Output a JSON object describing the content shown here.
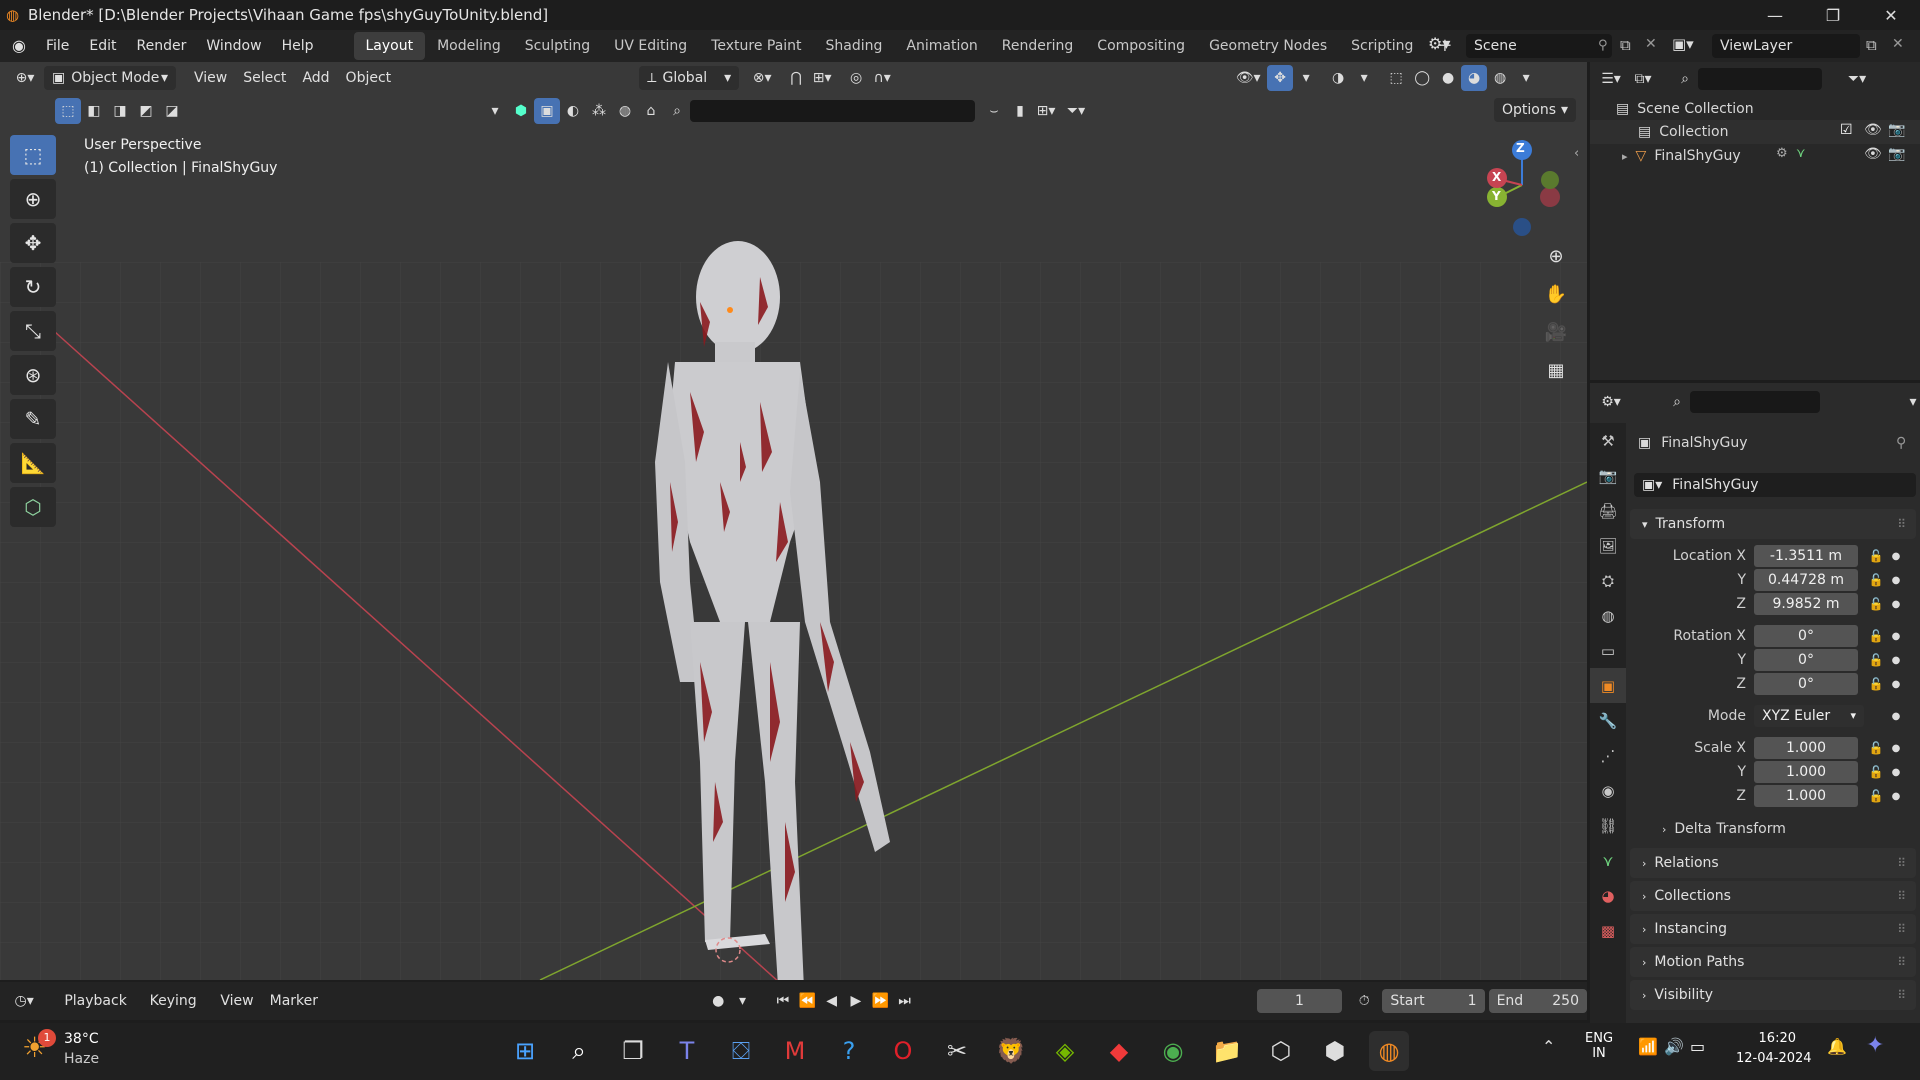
{
  "window": {
    "title": "Blender* [D:\\Blender Projects\\Vihaan Game fps\\shyGuyToUnity.blend]",
    "controls": [
      "—",
      "❐",
      "✕"
    ]
  },
  "menubar": {
    "menus": [
      "File",
      "Edit",
      "Render",
      "Window",
      "Help"
    ],
    "workspaces": [
      "Layout",
      "Modeling",
      "Sculpting",
      "UV Editing",
      "Texture Paint",
      "Shading",
      "Animation",
      "Rendering",
      "Compositing",
      "Geometry Nodes",
      "Scripting"
    ],
    "active_workspace": "Layout",
    "add_tab": "+",
    "scene_label": "Scene",
    "viewlayer_label": "ViewLayer"
  },
  "viewport": {
    "mode": "Object Mode",
    "menus": [
      "View",
      "Select",
      "Add",
      "Object"
    ],
    "transform_orientation": "Global",
    "options_label": "Options",
    "info_line1": "User Perspective",
    "info_line2": "(1) Collection | FinalShyGuy",
    "gizmo": {
      "z": "Z",
      "y": "Y",
      "x": "X"
    }
  },
  "outliner": {
    "items": [
      {
        "label": "Scene Collection"
      },
      {
        "label": "Collection"
      },
      {
        "label": "FinalShyGuy"
      }
    ]
  },
  "properties": {
    "object_name": "FinalShyGuy",
    "datablock_name": "FinalShyGuy",
    "transform_header": "Transform",
    "location": {
      "label": "Location X",
      "x": "-1.3511 m",
      "y": "0.44728 m",
      "z": "9.9852 m"
    },
    "rotation": {
      "label": "Rotation X",
      "x": "0°",
      "y": "0°",
      "z": "0°"
    },
    "mode_label": "Mode",
    "mode_value": "XYZ Euler",
    "scale": {
      "label": "Scale X",
      "x": "1.000",
      "y": "1.000",
      "z": "1.000"
    },
    "axis_y": "Y",
    "axis_z": "Z",
    "delta_transform": "Delta Transform",
    "panels": [
      "Relations",
      "Collections",
      "Instancing",
      "Motion Paths",
      "Visibility"
    ]
  },
  "timeline": {
    "menus": [
      "Playback",
      "Keying",
      "View",
      "Marker"
    ],
    "current_frame": "1",
    "start_label": "Start",
    "start_value": "1",
    "end_label": "End",
    "end_value": "250"
  },
  "taskbar": {
    "weather_temp": "38°C",
    "weather_desc": "Haze",
    "weather_badge": "1",
    "lang_line1": "ENG",
    "lang_line2": "IN",
    "time": "16:20",
    "date": "12-04-2024"
  },
  "colors": {
    "accent": "#4772b3",
    "axis_x": "#c74452",
    "axis_y": "#88b332",
    "axis_z": "#3c7cd8"
  }
}
